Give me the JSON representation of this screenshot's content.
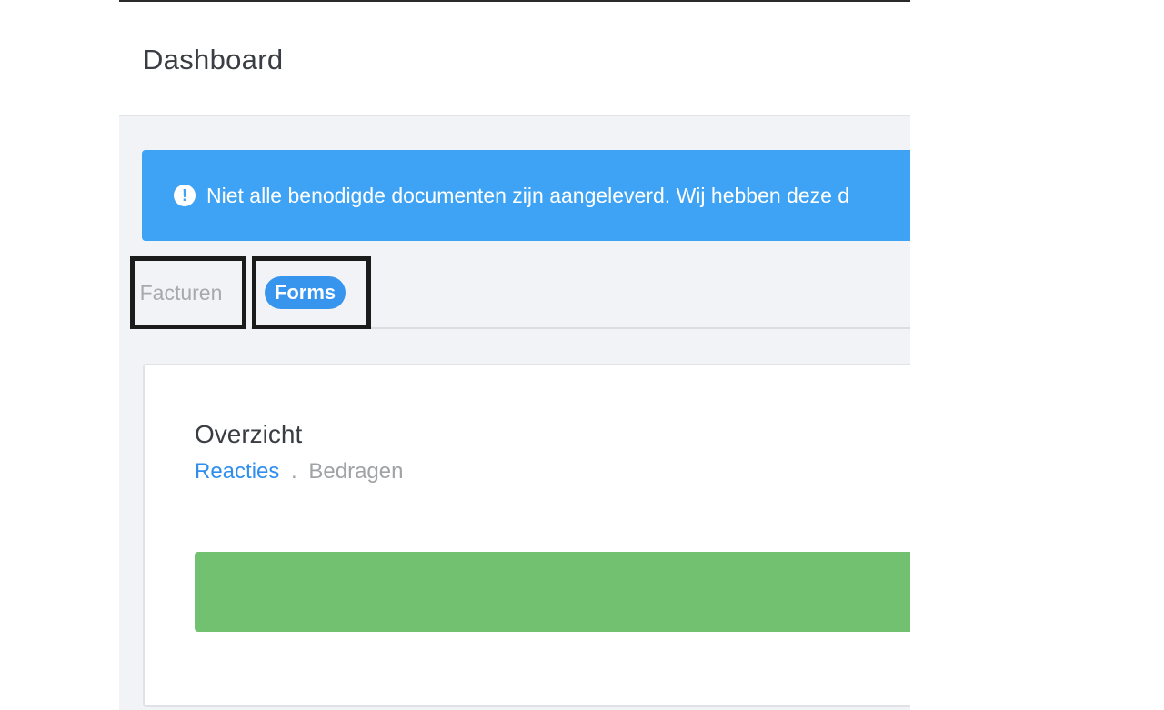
{
  "header": {
    "title": "Dashboard"
  },
  "alert": {
    "icon": "exclamation-circle-icon",
    "text": "Niet alle benodigde documenten zijn aangeleverd. Wij hebben deze d"
  },
  "tabs": [
    {
      "label": "Facturen",
      "active": false
    },
    {
      "label": "Forms",
      "active": true
    }
  ],
  "card": {
    "title": "Overzicht",
    "links": [
      {
        "label": "Reacties",
        "active": true
      },
      {
        "label": "Bedragen",
        "active": false
      }
    ],
    "separator": "."
  },
  "colors": {
    "alert_bg": "#3ea3f4",
    "active_tab": "#3895ee",
    "link_active": "#2f8eee",
    "progress": "#72c171"
  }
}
